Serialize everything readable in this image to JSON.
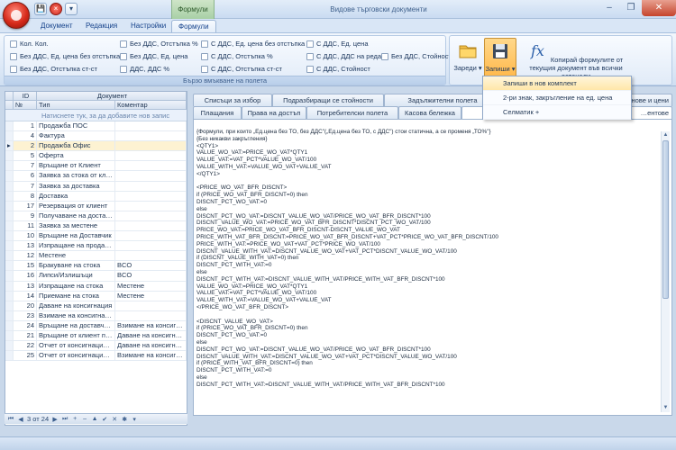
{
  "window": {
    "title": "Видове търговски документи",
    "context_tab_header": "Формули",
    "controls": [
      "–",
      "❐",
      "✕"
    ]
  },
  "quick_access": {
    "save": "💾",
    "close": "×",
    "more": "▾"
  },
  "ribbon_tabs": [
    {
      "label": "Документ",
      "active": false
    },
    {
      "label": "Редакция",
      "active": false
    },
    {
      "label": "Настройки",
      "active": false
    },
    {
      "label": "Формули",
      "active": true
    }
  ],
  "ribbon": {
    "field_group": {
      "label": "Бързо вмъкване на полета",
      "items": [
        "Кол. Кол.",
        "Без ДДС, Отстъпка %",
        "С ДДС, Ед. цена без отстъпка",
        "С ДДС, Ед. цена",
        "Без ДДС, Ед. цена без отстъпка",
        "Без ДДС, Ед. цена",
        "С ДДС, Отстъпка %",
        "С ДДС, ДДС на реда",
        "Без ДДС, Стойност",
        "Без ДДС, Отстъпка ст-ст",
        "ДДС, ДДС %",
        "С ДДС, Отстъпка ст-ст",
        "С ДДС, Стойност"
      ]
    },
    "load_button": "Зареди",
    "save_button": "Запиши",
    "copy_button": "Копирай формулите от текущия документ във всички останали"
  },
  "save_menu": [
    "Запиши в нов комплект",
    "2-ри знак, закръгление на ед. цена",
    "Селматик +"
  ],
  "left_grid": {
    "headers": {
      "id": "ID",
      "no": "№",
      "document": "Документ",
      "type": "Тип",
      "comment": "Коментар"
    },
    "new_row_hint": "Натиснете тук, за да добавите нов запис",
    "rows": [
      {
        "id": "1",
        "type": "Продажба ПОС",
        "comment": ""
      },
      {
        "id": "4",
        "type": "Фактура",
        "comment": ""
      },
      {
        "id": "2",
        "type": "Продажба Офис",
        "comment": ""
      },
      {
        "id": "5",
        "type": "Оферта",
        "comment": ""
      },
      {
        "id": "7",
        "type": "Връщане от Клиент",
        "comment": ""
      },
      {
        "id": "6",
        "type": "Заявка за стока от кли...",
        "comment": ""
      },
      {
        "id": "7",
        "type": "Заявка за доставка",
        "comment": ""
      },
      {
        "id": "8",
        "type": "Доставка",
        "comment": ""
      },
      {
        "id": "17",
        "type": "Резервация от клиент",
        "comment": ""
      },
      {
        "id": "9",
        "type": "Получаване на доставк...",
        "comment": ""
      },
      {
        "id": "11",
        "type": "Заявка за местене",
        "comment": ""
      },
      {
        "id": "10",
        "type": "Връщане на Доставчик",
        "comment": ""
      },
      {
        "id": "13",
        "type": "Изпращане на продажба",
        "comment": ""
      },
      {
        "id": "12",
        "type": "Местене",
        "comment": ""
      },
      {
        "id": "15",
        "type": "Бракуване на стока",
        "comment": "BCO"
      },
      {
        "id": "16",
        "type": "Липси/Излишъци",
        "comment": "BCO"
      },
      {
        "id": "13",
        "type": "Изпращане на стока",
        "comment": "Местене"
      },
      {
        "id": "14",
        "type": "Приемане на стока",
        "comment": "Местене"
      },
      {
        "id": "20",
        "type": "Даване на консигнация",
        "comment": ""
      },
      {
        "id": "23",
        "type": "Взимане на консигнация",
        "comment": ""
      },
      {
        "id": "24",
        "type": "Връщане на доставчик ...",
        "comment": "Взимане на консигнация"
      },
      {
        "id": "21",
        "type": "Връщане от клиент при...",
        "comment": "Даване на консигнация"
      },
      {
        "id": "22",
        "type": "Отчет от консигнация ...",
        "comment": "Даване на консигнация"
      },
      {
        "id": "25",
        "type": "Отчет от консигнация ...",
        "comment": "Взимане на консигнация"
      }
    ],
    "record_counter": "3 от 24"
  },
  "right_tabs_row1": [
    "Списъци за избор",
    "Подразбиращи се стойности",
    "Задължителни полета",
    "…нове и цени"
  ],
  "right_tabs_row2": [
    "Плащания",
    "Права на достъп",
    "Потребителски полета",
    "Касова бележка",
    "…ентове"
  ],
  "code_lines": [
    "{Формули, при които „Ед.цена без ТО, без ДДС\"(„Ед.цена без ТО, с ДДС\") стои статична, а се променя „ТО%\"}",
    "{Без никакви закръгления}",
    "<QTY1>",
    "VALUE_WO_VAT:=PRICE_WO_VAT*QTY1",
    "VALUE_VAT:=VAT_PCT*VALUE_WO_VAT/100",
    "VALUE_WITH_VAT:=VALUE_WO_VAT+VALUE_VAT",
    "</QTY1>",
    "",
    "<PRICE_WO_VAT_BFR_DISCNT>",
    "if (PRICE_WO_VAT_BFR_DISCNT=0) then",
    "DISCNT_PCT_WO_VAT:=0",
    "else",
    "DISCNT_PCT_WO_VAT:=DISCNT_VALUE_WO_VAT/PRICE_WO_VAT_BFR_DISCNT*100",
    "DISCNT_VALUE_WO_VAT:=PRICE_WO_VAT_BFR_DISCNT*DISCNT_PCT_WO_VAT/100",
    "PRICE_WO_VAT:=PRICE_WO_VAT_BFR_DISCNT-DISCNT_VALUE_WO_VAT",
    "PRICE_WITH_VAT_BFR_DISCNT:=PRICE_WO_VAT_BFR_DISCNT+VAT_PCT*PRICE_WO_VAT_BFR_DISCNT/100",
    "PRICE_WITH_VAT:=PRICE_WO_VAT+VAT_PCT*PRICE_WO_VAT/100",
    "DISCNT_VALUE_WITH_VAT:=DISCNT_VALUE_WO_VAT+VAT_PCT*DISCNT_VALUE_WO_VAT/100",
    "if (DISCNT_VALUE_WITH_VAT=0) then",
    "DISCNT_PCT_WITH_VAT:=0",
    "else",
    "DISCNT_PCT_WITH_VAT:=DISCNT_VALUE_WITH_VAT/PRICE_WITH_VAT_BFR_DISCNT*100",
    "VALUE_WO_VAT:=PRICE_WO_VAT*QTY1",
    "VALUE_VAT:=VAT_PCT*VALUE_WO_VAT/100",
    "VALUE_WITH_VAT:=VALUE_WO_VAT+VALUE_VAT",
    "</PRICE_WO_VAT_BFR_DISCNT>",
    "",
    "<DISCNT_VALUE_WO_VAT>",
    "if (PRICE_WO_VAT_BFR_DISCNT=0) then",
    "DISCNT_PCT_WO_VAT:=0",
    "else",
    "DISCNT_PCT_WO_VAT:=DISCNT_VALUE_WO_VAT/PRICE_WO_VAT_BFR_DISCNT*100",
    "DISCNT_VALUE_WITH_VAT:=DISCNT_VALUE_WO_VAT+VAT_PCT*DISCNT_VALUE_WO_VAT/100",
    "if (PRICE_WITH_VAT_BFR_DISCNT=0) then",
    "DISCNT_PCT_WITH_VAT:=0",
    "else",
    "DISCNT_PCT_WITH_VAT:=DISCNT_VALUE_WITH_VAT/PRICE_WITH_VAT_BFR_DISCNT*100"
  ],
  "colors": {
    "accent": "#15428b",
    "highlight": "#ffc25a",
    "close": "#c5442c"
  }
}
